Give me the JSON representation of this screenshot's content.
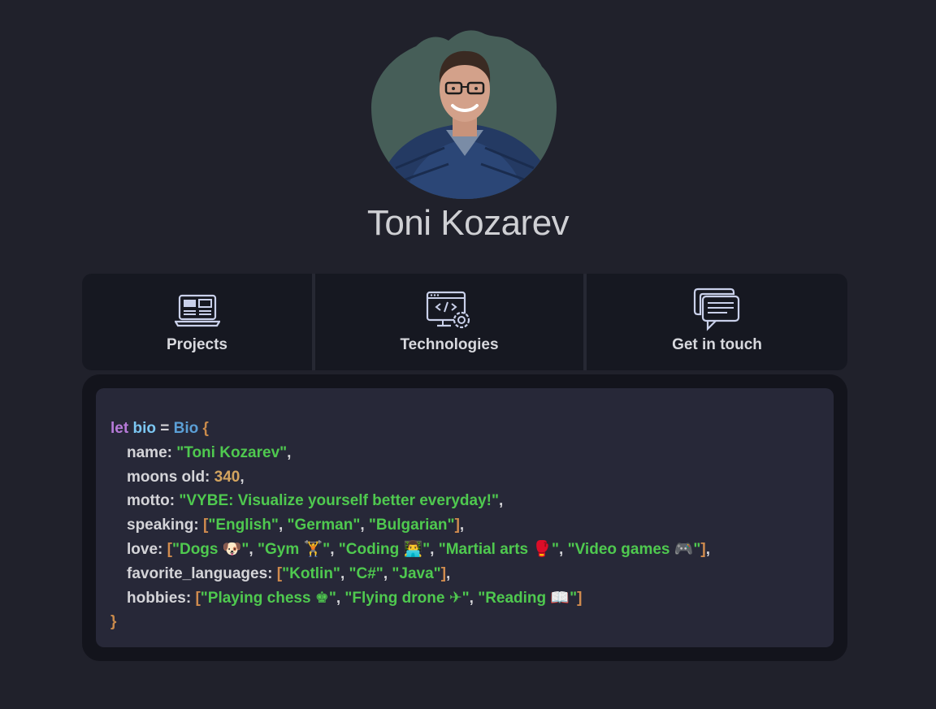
{
  "profile": {
    "name": "Toni Kozarev",
    "avatar_alt": "profile photo"
  },
  "nav": {
    "items": [
      {
        "label": "Projects",
        "icon": "laptop-icon"
      },
      {
        "label": "Technologies",
        "icon": "code-settings-icon"
      },
      {
        "label": "Get in touch",
        "icon": "chat-icon"
      }
    ]
  },
  "bio": {
    "keyword": "let",
    "variable": "bio",
    "equals": "=",
    "type": "Bio",
    "open_brace": "{",
    "close_brace": "}",
    "name_key": "name:",
    "name_value": "\"Toni Kozarev\"",
    "moons_key": "moons old:",
    "moons_value": "340",
    "motto_key": "motto:",
    "motto_value": "\"VYBE: Visualize yourself better everyday!\"",
    "speaking_key": "speaking:",
    "speaking_values": [
      "\"English\"",
      "\"German\"",
      "\"Bulgarian\""
    ],
    "love_key": "love:",
    "love_values": [
      "\"Dogs 🐶\"",
      "\"Gym 🏋\"",
      "\"Coding 👨‍💻\"",
      "\"Martial arts 🥊\"",
      "\"Video games 🎮\""
    ],
    "languages_key": "favorite_languages:",
    "languages_values": [
      "\"Kotlin\"",
      "\"C#\"",
      "\"Java\""
    ],
    "hobbies_key": "hobbies:",
    "hobbies_values": [
      "\"Playing chess ♚\"",
      "\"Flying drone ✈\"",
      "\"Reading 📖\""
    ]
  },
  "colors": {
    "background": "#20212b",
    "card": "#161821",
    "code_bg": "#272838",
    "string": "#4fc94f",
    "number": "#d3a45f",
    "keyword": "#b77ad9",
    "variable": "#7cc7f2",
    "type": "#5b9fd6",
    "bracket": "#d08b4e"
  }
}
